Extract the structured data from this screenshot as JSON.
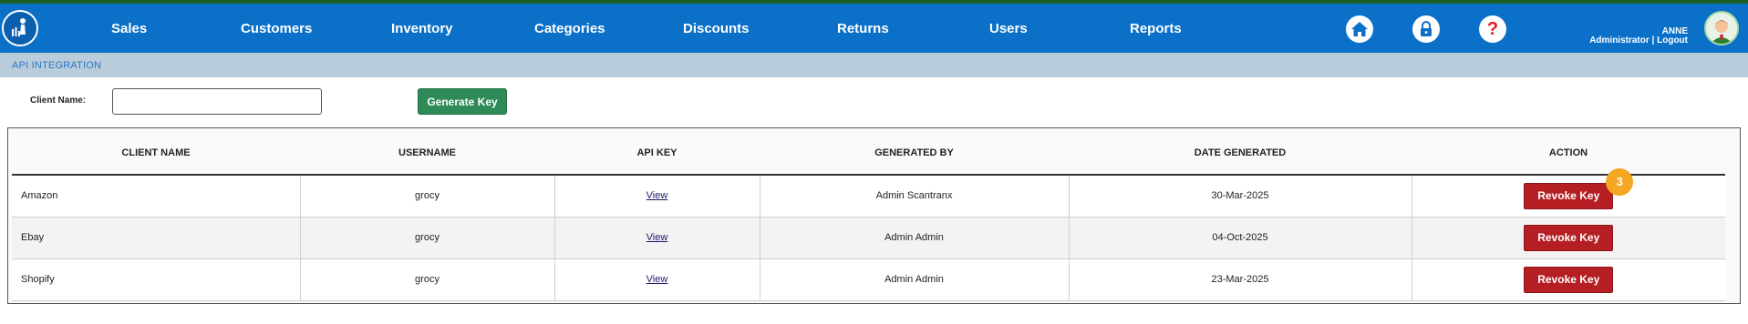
{
  "nav": {
    "items": [
      "Sales",
      "Customers",
      "Inventory",
      "Categories",
      "Discounts",
      "Returns",
      "Users",
      "Reports"
    ],
    "icons": [
      "home-icon",
      "lock-icon",
      "help-icon"
    ],
    "help_glyph": "?"
  },
  "user": {
    "name": "ANNE",
    "role": "Administrator",
    "separator": "|",
    "logout": "Logout"
  },
  "section": {
    "title": "API INTEGRATION"
  },
  "form": {
    "client_label": "Client Name:",
    "client_value": "",
    "generate_label": "Generate Key"
  },
  "table": {
    "headers": [
      "CLIENT NAME",
      "USERNAME",
      "API KEY",
      "GENERATED BY",
      "DATE GENERATED",
      "ACTION"
    ],
    "rows": [
      {
        "client": "Amazon",
        "username": "grocy",
        "api_key": "View",
        "generated_by": "Admin Scantranx",
        "date": "30-Mar-2025",
        "action": "Revoke Key"
      },
      {
        "client": "Ebay",
        "username": "grocy",
        "api_key": "View",
        "generated_by": "Admin Admin",
        "date": "04-Oct-2025",
        "action": "Revoke Key"
      },
      {
        "client": "Shopify",
        "username": "grocy",
        "api_key": "View",
        "generated_by": "Admin Admin",
        "date": "23-Mar-2025",
        "action": "Revoke Key"
      }
    ]
  },
  "badge": {
    "count": "3"
  },
  "colors": {
    "nav_bg": "#0a70c8",
    "section_bg": "#b9ccdc",
    "generate_button": "#2e8b57",
    "revoke_button": "#b51f23",
    "badge": "#f5a623"
  }
}
